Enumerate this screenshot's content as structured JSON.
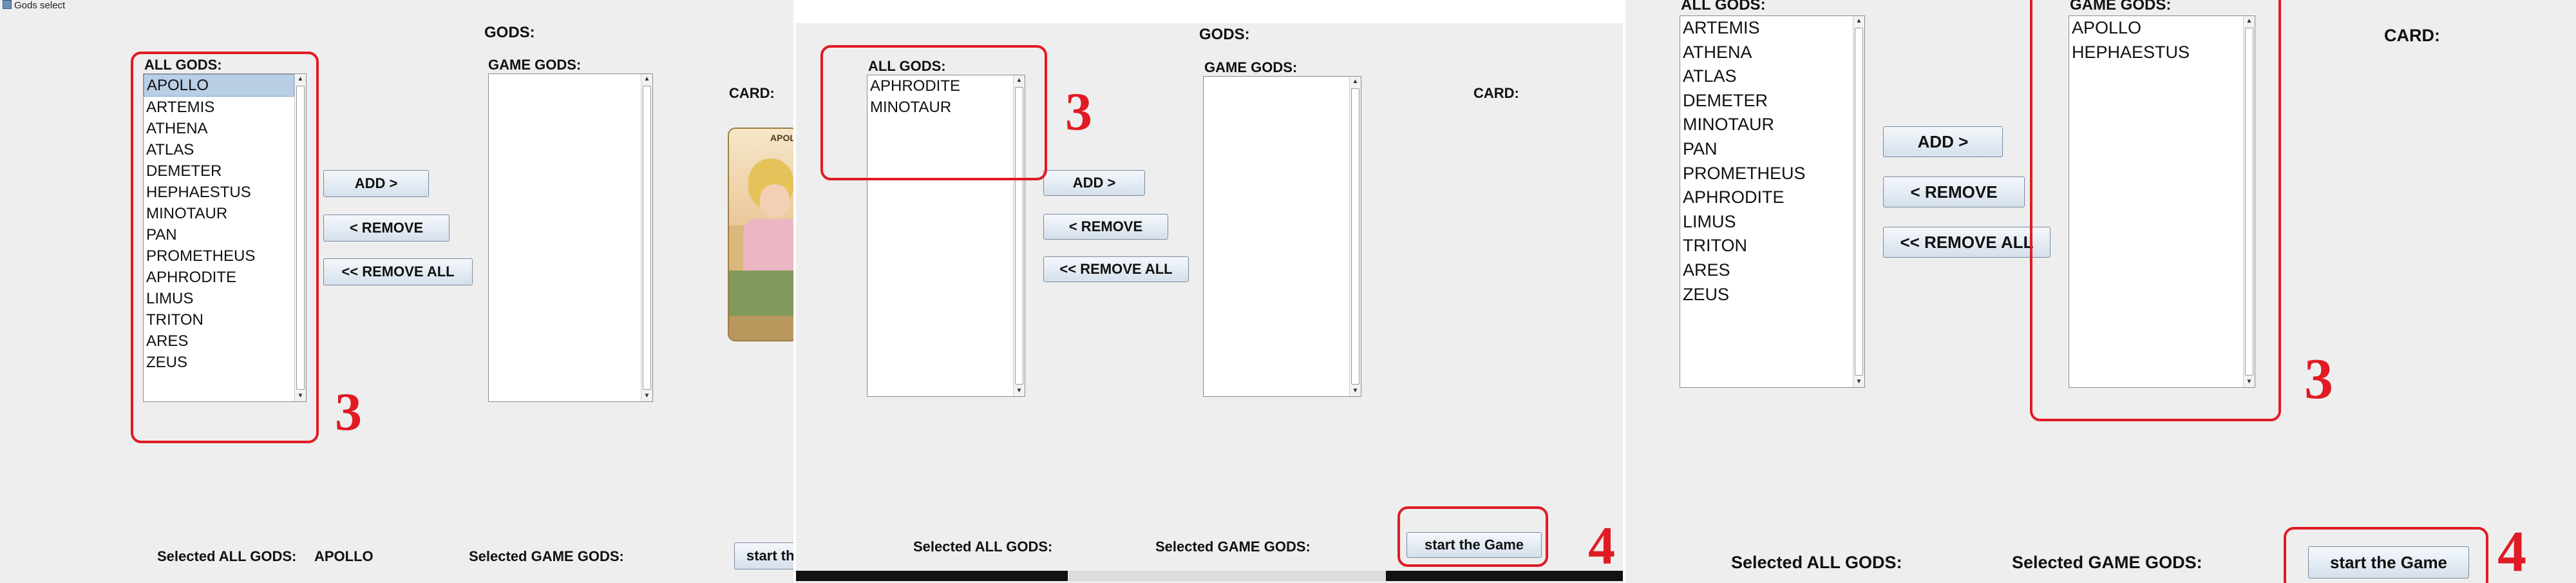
{
  "window": {
    "title": "Gods select"
  },
  "shared": {
    "gods_title": "GODS:",
    "all_gods_label": "ALL GODS:",
    "game_gods_label": "GAME GODS:",
    "card_label": "CARD:",
    "add_label": "ADD >",
    "remove_label": "< REMOVE",
    "remove_all_label": "<< REMOVE ALL",
    "selected_all_label": "Selected ALL GODS:",
    "selected_game_label": "Selected GAME GODS:",
    "start_label": "start the Game"
  },
  "panel1": {
    "all_gods": [
      "APOLLO",
      "ARTEMIS",
      "ATHENA",
      "ATLAS",
      "DEMETER",
      "HEPHAESTUS",
      "MINOTAUR",
      "PAN",
      "PROMETHEUS",
      "APHRODITE",
      "LIMUS",
      "TRITON",
      "ARES",
      "ZEUS"
    ],
    "selected_item": "APOLLO",
    "game_gods": [],
    "selected_all_value": "APOLLO",
    "selected_game_value": "",
    "start_button_partial": "start th",
    "card_caption": "APOL",
    "annotation": "3"
  },
  "panel2": {
    "all_gods": [
      "APHRODITE",
      "MINOTAUR"
    ],
    "game_gods": [],
    "annotation_list": "3",
    "annotation_start": "4"
  },
  "panel3": {
    "all_gods": [
      "ARTEMIS",
      "ATHENA",
      "ATLAS",
      "DEMETER",
      "MINOTAUR",
      "PAN",
      "PROMETHEUS",
      "APHRODITE",
      "LIMUS",
      "TRITON",
      "ARES",
      "ZEUS"
    ],
    "game_gods": [
      "APOLLO",
      "HEPHAESTUS"
    ],
    "remove_all_partial": "<< REMOVE ALL",
    "annotation_list": "3",
    "annotation_start": "4"
  },
  "colors": {
    "annotation": "#e01b24",
    "panel_bg": "#eeeeee",
    "selection": "#b8cfe5"
  }
}
